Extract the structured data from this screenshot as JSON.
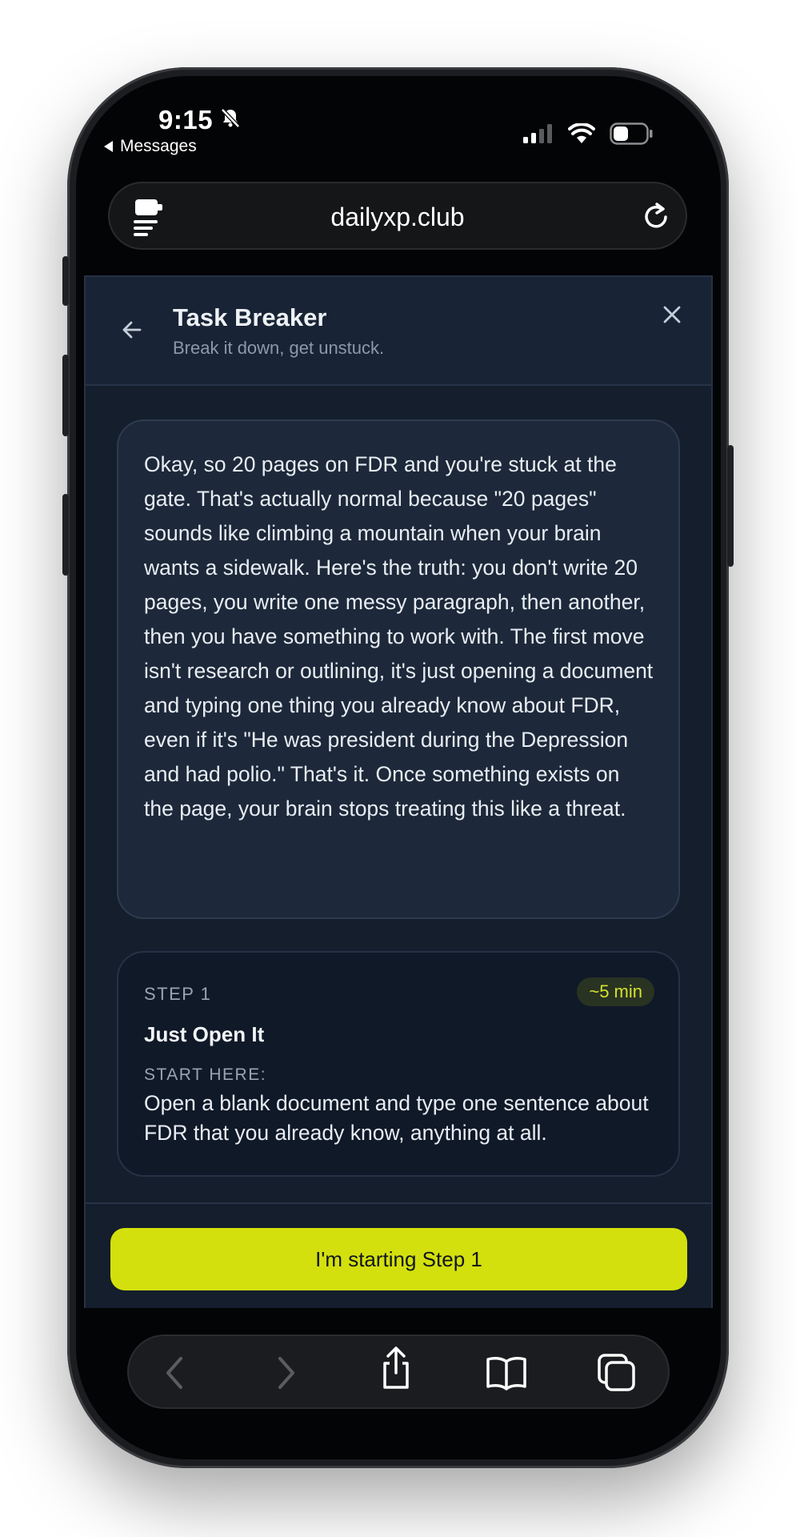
{
  "status_bar": {
    "time": "9:15",
    "back_app": "Messages",
    "icons": [
      "bell-slash-icon",
      "cellular-signal-icon",
      "wifi-icon",
      "battery-icon"
    ]
  },
  "browser": {
    "url": "dailyxp.club",
    "left_icon": "reader-menu-icon",
    "right_icon": "reload-icon"
  },
  "panel": {
    "title": "Task Breaker",
    "subtitle": "Break it down, get unstuck."
  },
  "message": {
    "text": "Okay, so 20 pages on FDR and you're stuck at the gate. That's actually normal because \"20 pages\" sounds like climbing a mountain when your brain wants a sidewalk. Here's the truth: you don't write 20 pages, you write one messy paragraph, then another, then you have something to work with. The first move isn't research or outlining, it's just opening a document and typing one thing you already know about FDR, even if it's \"He was president during the Depression and had polio.\" That's it. Once something exists on the page, your brain stops treating this like a threat."
  },
  "step": {
    "label": "STEP 1",
    "duration": "~5 min",
    "title": "Just Open It",
    "start_label": "START HERE:",
    "start_text": "Open a blank document and type one sentence about FDR that you already know, anything at all."
  },
  "cta": {
    "label": "I'm starting Step 1"
  },
  "colors": {
    "accent": "#d4e00d",
    "panel_bg": "#141e2c",
    "card_bg": "#1d293a"
  },
  "toolbar": {
    "icons": [
      "back-icon",
      "forward-icon",
      "share-icon",
      "bookmarks-icon",
      "tabs-icon"
    ]
  }
}
